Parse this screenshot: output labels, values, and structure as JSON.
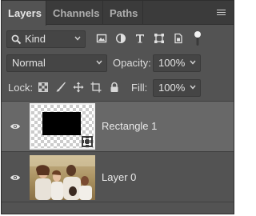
{
  "tabs": [
    {
      "label": "Layers"
    },
    {
      "label": "Channels"
    },
    {
      "label": "Paths"
    }
  ],
  "filter": {
    "kind_label": "Kind"
  },
  "blend": {
    "mode": "Normal",
    "opacity_label": "Opacity:",
    "opacity_value": "100%"
  },
  "lock": {
    "label": "Lock:",
    "fill_label": "Fill:",
    "fill_value": "100%"
  },
  "layers": [
    {
      "name": "Rectangle 1",
      "selected": true
    },
    {
      "name": "Layer 0",
      "selected": false
    }
  ],
  "colors": {
    "panel": "#535353",
    "tabbar": "#3b3b3b",
    "selected_row": "#686868"
  }
}
